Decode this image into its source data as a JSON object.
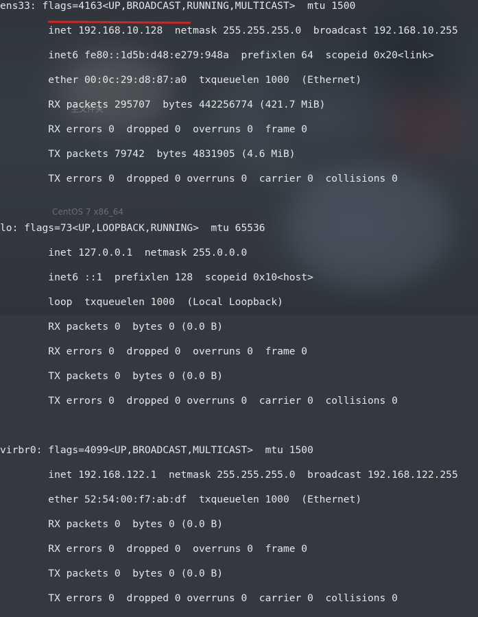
{
  "lines": [
    "ens33: flags=4163<UP,BROADCAST,RUNNING,MULTICAST>  mtu 1500",
    "        inet 192.168.10.128  netmask 255.255.255.0  broadcast 192.168.10.255",
    "        inet6 fe80::1d5b:d48:e279:948a  prefixlen 64  scopeid 0x20<link>",
    "        ether 00:0c:29:d8:87:a0  txqueuelen 1000  (Ethernet)",
    "        RX packets 295707  bytes 442256774 (421.7 MiB)",
    "        RX errors 0  dropped 0  overruns 0  frame 0",
    "        TX packets 79742  bytes 4831905 (4.6 MiB)",
    "        TX errors 0  dropped 0 overruns 0  carrier 0  collisions 0",
    "",
    "lo: flags=73<UP,LOOPBACK,RUNNING>  mtu 65536",
    "        inet 127.0.0.1  netmask 255.0.0.0",
    "        inet6 ::1  prefixlen 128  scopeid 0x10<host>",
    "        loop  txqueuelen 1000  (Local Loopback)",
    "        RX packets 0  bytes 0 (0.0 B)",
    "        RX errors 0  dropped 0  overruns 0  frame 0",
    "        TX packets 0  bytes 0 (0.0 B)",
    "        TX errors 0  dropped 0 overruns 0  carrier 0  collisions 0",
    "",
    "virbr0: flags=4099<UP,BROADCAST,MULTICAST>  mtu 1500",
    "        inet 192.168.122.1  netmask 255.255.255.0  broadcast 192.168.122.255",
    "        ether 52:54:00:f7:ab:df  txqueuelen 1000  (Ethernet)",
    "        RX packets 0  bytes 0 (0.0 B)",
    "        RX errors 0  dropped 0  overruns 0  frame 0",
    "        TX packets 0  bytes 0 (0.0 B)",
    "        TX errors 0  dropped 0 overruns 0  carrier 0  collisions 0"
  ],
  "watermarks": {
    "top": "主文件夹",
    "bottom": "CentOS 7 x86_64"
  },
  "colors": {
    "text": "#e4e6e8",
    "highlight": "#e0201c",
    "background": "#33393f"
  }
}
